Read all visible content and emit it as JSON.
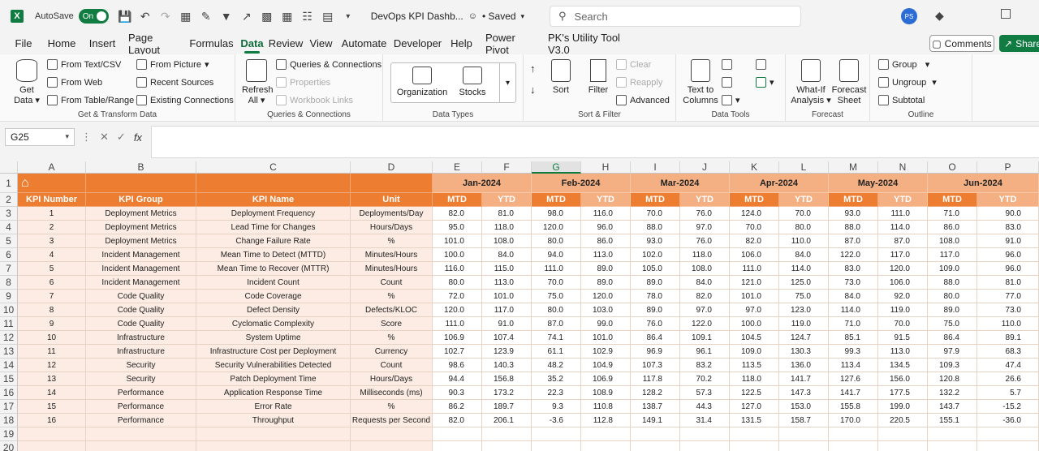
{
  "titlebar": {
    "autosave_label": "AutoSave",
    "toggle_label": "On",
    "file_name": "DevOps KPI Dashb...",
    "save_status": "• Saved",
    "search_placeholder": "Search",
    "avatar_initials": "PS"
  },
  "menu": {
    "tabs": [
      "File",
      "Home",
      "Insert",
      "Page Layout",
      "Formulas",
      "Data",
      "Review",
      "View",
      "Automate",
      "Developer",
      "Help",
      "Power Pivot",
      "PK's Utility Tool V3.0"
    ],
    "active_tab": "Data",
    "comments_label": "Comments",
    "share_label": "Share"
  },
  "ribbon": {
    "get_transform": {
      "label": "Get & Transform Data",
      "get_data": "Get Data",
      "from_text_csv": "From Text/CSV",
      "from_web": "From Web",
      "from_table_range": "From Table/Range",
      "from_picture": "From Picture",
      "recent_sources": "Recent Sources",
      "existing_connections": "Existing Connections"
    },
    "queries": {
      "label": "Queries & Connections",
      "refresh_all": "Refresh All",
      "queries_connections": "Queries & Connections",
      "properties": "Properties",
      "workbook_links": "Workbook Links"
    },
    "data_types": {
      "label": "Data Types",
      "organization": "Organization",
      "stocks": "Stocks"
    },
    "sort_filter": {
      "label": "Sort & Filter",
      "sort": "Sort",
      "filter": "Filter",
      "clear": "Clear",
      "reapply": "Reapply",
      "advanced": "Advanced"
    },
    "data_tools": {
      "label": "Data Tools",
      "text_to_columns": "Text to Columns"
    },
    "forecast": {
      "label": "Forecast",
      "what_if": "What-If Analysis",
      "forecast_sheet": "Forecast Sheet"
    },
    "outline": {
      "label": "Outline",
      "group": "Group",
      "ungroup": "Ungroup",
      "subtotal": "Subtotal"
    }
  },
  "formula_bar": {
    "name_box": "G25",
    "fx": "fx",
    "formula": ""
  },
  "grid": {
    "columns": [
      "A",
      "B",
      "C",
      "D",
      "E",
      "F",
      "G",
      "H",
      "I",
      "J",
      "K",
      "L",
      "M",
      "N",
      "O",
      "P"
    ],
    "selected_column": "G",
    "row_numbers": [
      "1",
      "2",
      "3",
      "4",
      "5",
      "6",
      "7",
      "8",
      "9",
      "10",
      "11",
      "12",
      "13",
      "14",
      "15",
      "16",
      "17",
      "18",
      "19",
      "20"
    ],
    "headers": [
      "KPI Number",
      "KPI Group",
      "KPI Name",
      "Unit"
    ],
    "months": [
      "Jan-2024",
      "Feb-2024",
      "Mar-2024",
      "Apr-2024",
      "May-2024",
      "Jun-2024"
    ],
    "sub_headers": [
      "MTD",
      "YTD"
    ],
    "rows": [
      {
        "num": "1",
        "group": "Deployment Metrics",
        "name": "Deployment Frequency",
        "unit": "Deployments/Day",
        "vals": [
          "82.0",
          "81.0",
          "98.0",
          "116.0",
          "70.0",
          "76.0",
          "124.0",
          "70.0",
          "93.0",
          "111.0",
          "71.0",
          "90.0"
        ]
      },
      {
        "num": "2",
        "group": "Deployment Metrics",
        "name": "Lead Time for Changes",
        "unit": "Hours/Days",
        "vals": [
          "95.0",
          "118.0",
          "120.0",
          "96.0",
          "88.0",
          "97.0",
          "70.0",
          "80.0",
          "88.0",
          "114.0",
          "86.0",
          "83.0"
        ]
      },
      {
        "num": "3",
        "group": "Deployment Metrics",
        "name": "Change Failure Rate",
        "unit": "%",
        "vals": [
          "101.0",
          "108.0",
          "80.0",
          "86.0",
          "93.0",
          "76.0",
          "82.0",
          "110.0",
          "87.0",
          "87.0",
          "108.0",
          "91.0"
        ]
      },
      {
        "num": "4",
        "group": "Incident Management",
        "name": "Mean Time to Detect (MTTD)",
        "unit": "Minutes/Hours",
        "vals": [
          "100.0",
          "84.0",
          "94.0",
          "113.0",
          "102.0",
          "118.0",
          "106.0",
          "84.0",
          "122.0",
          "117.0",
          "117.0",
          "96.0"
        ]
      },
      {
        "num": "5",
        "group": "Incident Management",
        "name": "Mean Time to Recover (MTTR)",
        "unit": "Minutes/Hours",
        "vals": [
          "116.0",
          "115.0",
          "111.0",
          "89.0",
          "105.0",
          "108.0",
          "111.0",
          "114.0",
          "83.0",
          "120.0",
          "109.0",
          "96.0"
        ]
      },
      {
        "num": "6",
        "group": "Incident Management",
        "name": "Incident Count",
        "unit": "Count",
        "vals": [
          "80.0",
          "113.0",
          "70.0",
          "89.0",
          "89.0",
          "84.0",
          "121.0",
          "125.0",
          "73.0",
          "106.0",
          "88.0",
          "81.0"
        ]
      },
      {
        "num": "7",
        "group": "Code Quality",
        "name": "Code Coverage",
        "unit": "%",
        "vals": [
          "72.0",
          "101.0",
          "75.0",
          "120.0",
          "78.0",
          "82.0",
          "101.0",
          "75.0",
          "84.0",
          "92.0",
          "80.0",
          "77.0"
        ]
      },
      {
        "num": "8",
        "group": "Code Quality",
        "name": "Defect Density",
        "unit": "Defects/KLOC",
        "vals": [
          "120.0",
          "117.0",
          "80.0",
          "103.0",
          "89.0",
          "97.0",
          "97.0",
          "123.0",
          "114.0",
          "119.0",
          "89.0",
          "73.0"
        ]
      },
      {
        "num": "9",
        "group": "Code Quality",
        "name": "Cyclomatic Complexity",
        "unit": "Score",
        "vals": [
          "111.0",
          "91.0",
          "87.0",
          "99.0",
          "76.0",
          "122.0",
          "100.0",
          "119.0",
          "71.0",
          "70.0",
          "75.0",
          "110.0"
        ]
      },
      {
        "num": "10",
        "group": "Infrastructure",
        "name": "System Uptime",
        "unit": "%",
        "vals": [
          "106.9",
          "107.4",
          "74.1",
          "101.0",
          "86.4",
          "109.1",
          "104.5",
          "124.7",
          "85.1",
          "91.5",
          "86.4",
          "89.1"
        ]
      },
      {
        "num": "11",
        "group": "Infrastructure",
        "name": "Infrastructure Cost per Deployment",
        "unit": "Currency",
        "vals": [
          "102.7",
          "123.9",
          "61.1",
          "102.9",
          "96.9",
          "96.1",
          "109.0",
          "130.3",
          "99.3",
          "113.0",
          "97.9",
          "68.3"
        ]
      },
      {
        "num": "12",
        "group": "Security",
        "name": "Security Vulnerabilities Detected",
        "unit": "Count",
        "vals": [
          "98.6",
          "140.3",
          "48.2",
          "104.9",
          "107.3",
          "83.2",
          "113.5",
          "136.0",
          "113.4",
          "134.5",
          "109.3",
          "47.4"
        ]
      },
      {
        "num": "13",
        "group": "Security",
        "name": "Patch Deployment Time",
        "unit": "Hours/Days",
        "vals": [
          "94.4",
          "156.8",
          "35.2",
          "106.9",
          "117.8",
          "70.2",
          "118.0",
          "141.7",
          "127.6",
          "156.0",
          "120.8",
          "26.6"
        ]
      },
      {
        "num": "14",
        "group": "Performance",
        "name": "Application Response Time",
        "unit": "Milliseconds (ms)",
        "vals": [
          "90.3",
          "173.2",
          "22.3",
          "108.9",
          "128.2",
          "57.3",
          "122.5",
          "147.3",
          "141.7",
          "177.5",
          "132.2",
          "5.7"
        ]
      },
      {
        "num": "15",
        "group": "Performance",
        "name": "Error Rate",
        "unit": "%",
        "vals": [
          "86.2",
          "189.7",
          "9.3",
          "110.8",
          "138.7",
          "44.3",
          "127.0",
          "153.0",
          "155.8",
          "199.0",
          "143.7",
          "-15.2"
        ]
      },
      {
        "num": "16",
        "group": "Performance",
        "name": "Throughput",
        "unit": "Requests per Second",
        "vals": [
          "82.0",
          "206.1",
          "-3.6",
          "112.8",
          "149.1",
          "31.4",
          "131.5",
          "158.7",
          "170.0",
          "220.5",
          "155.1",
          "-36.0"
        ]
      }
    ]
  }
}
